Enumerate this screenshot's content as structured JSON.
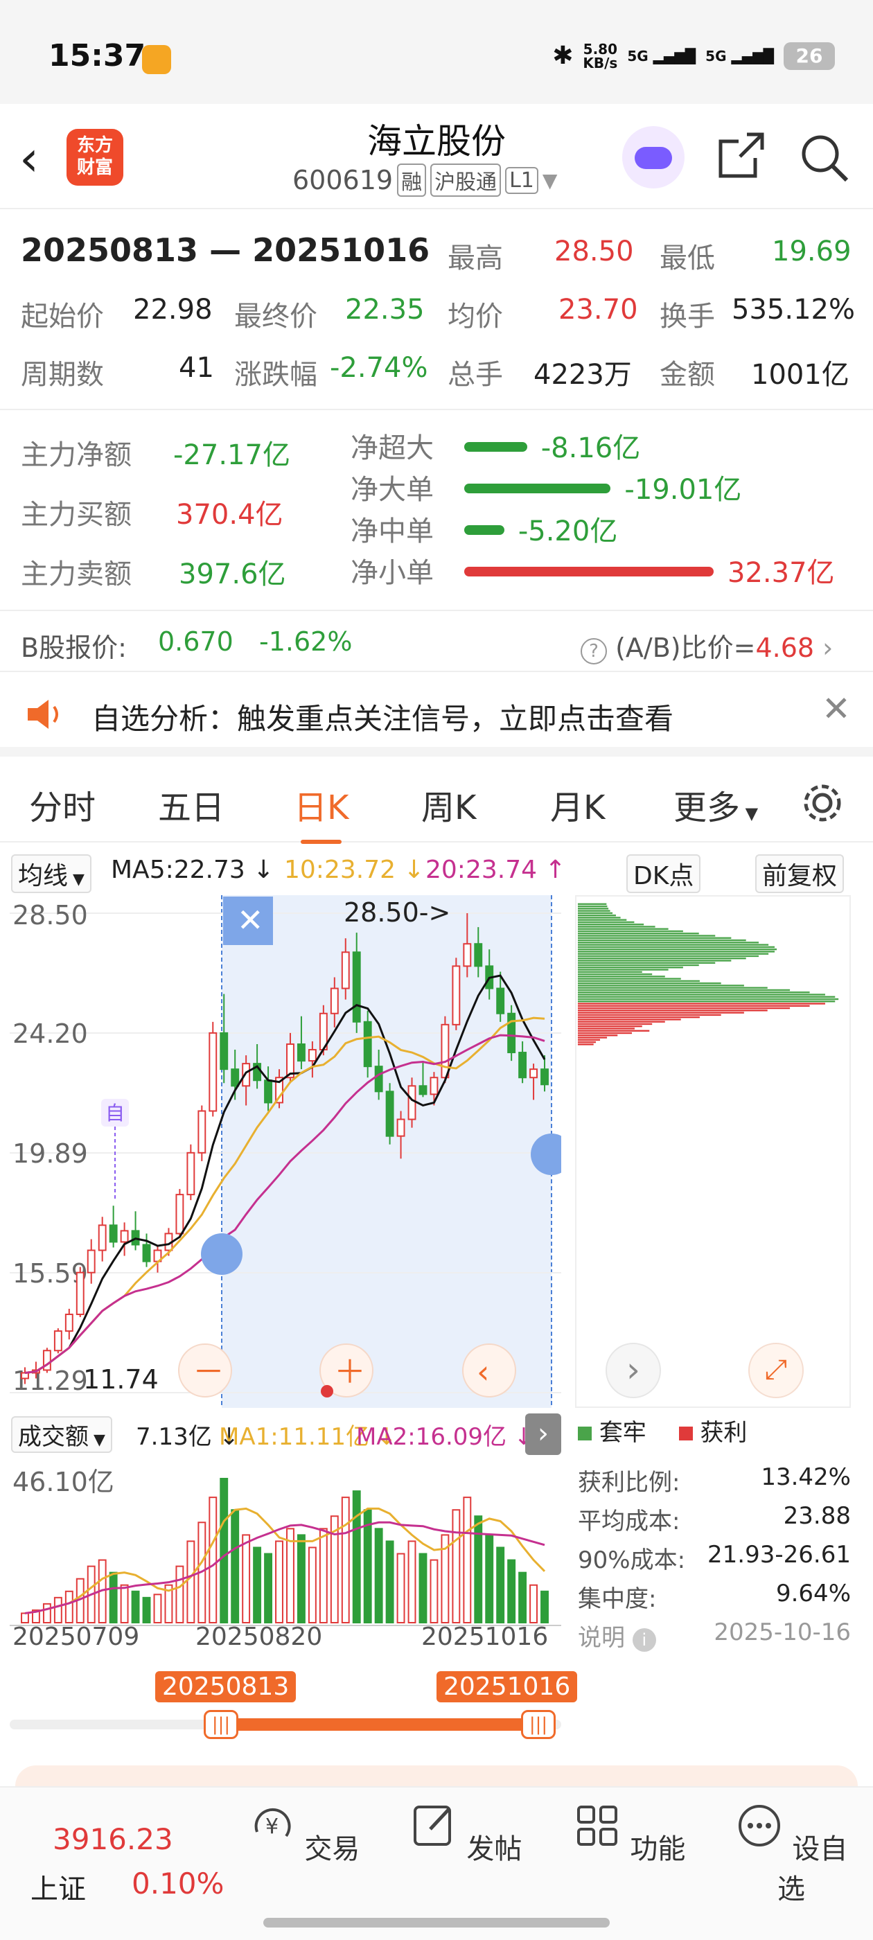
{
  "status": {
    "time": "15:37",
    "speed_value": "5.80",
    "speed_unit": "KB/s",
    "net1": "5G",
    "net2": "5G",
    "battery": "26"
  },
  "header": {
    "back_icon": "chevron-left-icon",
    "logo_line1": "东方",
    "logo_line2": "财富",
    "title": "海立股份",
    "code": "600619",
    "tags": [
      "融",
      "沪股通",
      "L1"
    ]
  },
  "range": {
    "label": "20250813 — 20251016"
  },
  "stats": {
    "high_label": "最高",
    "high": "28.50",
    "low_label": "最低",
    "low": "19.69",
    "start_label": "起始价",
    "start": "22.98",
    "end_label": "最终价",
    "end": "22.35",
    "avg_label": "均价",
    "avg": "23.70",
    "turnover_label": "换手",
    "turnover": "535.12%",
    "periods_label": "周期数",
    "periods": "41",
    "change_label": "涨跌幅",
    "change": "-2.74%",
    "hands_label": "总手",
    "hands": "4223万",
    "amount_label": "金额",
    "amount": "1001亿"
  },
  "fund": {
    "net_label": "主力净额",
    "net": "-27.17亿",
    "buy_label": "主力买额",
    "buy": "370.4亿",
    "sell_label": "主力卖额",
    "sell": "397.6亿",
    "flows": [
      {
        "label": "净超大",
        "value": "-8.16亿",
        "color": "#2e9e3a",
        "magnitude": 8.16
      },
      {
        "label": "净大单",
        "value": "-19.01亿",
        "color": "#2e9e3a",
        "magnitude": 19.01
      },
      {
        "label": "净中单",
        "value": "-5.20亿",
        "color": "#2e9e3a",
        "magnitude": 5.2
      },
      {
        "label": "净小单",
        "value": "32.37亿",
        "color": "#e03a3a",
        "magnitude": 32.37
      }
    ]
  },
  "bprice": {
    "label": "B股报价:",
    "price": "0.670",
    "change": "-1.62%",
    "ratio_label": "(A/B)比价=",
    "ratio": "4.68"
  },
  "alert": {
    "text": "自选分析：触发重点关注信号，立即点击查看"
  },
  "tabs": [
    "分时",
    "五日",
    "日K",
    "周K",
    "月K",
    "更多"
  ],
  "ma": {
    "selector": "均线",
    "ma5": "MA5:22.73 ↓",
    "ma10": "10:23.72 ↓",
    "ma20": "20:23.74 ↑",
    "dk": "DK点",
    "fq": "前复权"
  },
  "chart": {
    "y_labels": [
      "28.50",
      "24.20",
      "19.89",
      "15.59",
      "11.29"
    ],
    "peak_label": "28.50->",
    "low_label": "11.74",
    "marker": "自"
  },
  "volume": {
    "selector": "成交额",
    "val": "7.13亿 ↓",
    "ma1": "MA1:11.11亿 ↓",
    "ma2": "MA2:16.09亿 ↓",
    "max_label": "46.10亿",
    "date_start": "20250709",
    "date_mid": "20250820",
    "date_end": "20251016"
  },
  "range_flags": {
    "start": "20250813",
    "end": "20251016"
  },
  "chips": {
    "legend_hold": "套牢",
    "legend_profit": "获利",
    "rows": [
      {
        "label": "获利比例:",
        "value": "13.42%"
      },
      {
        "label": "平均成本:",
        "value": "23.88"
      },
      {
        "label": "90%成本:",
        "value": "21.93-26.61"
      },
      {
        "label": "集中度:",
        "value": "9.64%"
      }
    ],
    "note_label": "说明",
    "date": "2025-10-16"
  },
  "bottom": {
    "index_value": "3916.23",
    "index_name": "上证",
    "index_change": "0.10%",
    "items": [
      {
        "label": "交易",
        "icon": "yen-cycle-icon"
      },
      {
        "label": "发帖",
        "icon": "edit-icon"
      },
      {
        "label": "功能",
        "icon": "grid-icon"
      },
      {
        "label": "设自选",
        "icon": "more-icon"
      }
    ]
  },
  "chart_data": {
    "type": "candlestick",
    "x_start": "20250709",
    "x_end": "20251016",
    "ylim": [
      11.29,
      28.5
    ],
    "selection": [
      "20250813",
      "20251016"
    ],
    "ohlc": [
      [
        11.8,
        12.2,
        11.6,
        12.0
      ],
      [
        12.0,
        12.4,
        11.8,
        12.1
      ],
      [
        12.1,
        12.9,
        12.0,
        12.8
      ],
      [
        12.8,
        13.6,
        12.7,
        13.5
      ],
      [
        13.5,
        14.3,
        13.2,
        14.1
      ],
      [
        14.1,
        15.8,
        14.0,
        15.6
      ],
      [
        15.6,
        16.8,
        15.2,
        16.4
      ],
      [
        16.4,
        17.6,
        16.0,
        17.3
      ],
      [
        17.3,
        18.0,
        16.5,
        16.7
      ],
      [
        16.7,
        17.4,
        16.2,
        17.1
      ],
      [
        17.1,
        17.8,
        16.4,
        16.6
      ],
      [
        16.6,
        17.0,
        15.8,
        16.0
      ],
      [
        16.0,
        16.6,
        15.6,
        16.4
      ],
      [
        16.4,
        17.2,
        16.2,
        17.0
      ],
      [
        17.0,
        18.6,
        16.9,
        18.4
      ],
      [
        18.4,
        20.2,
        18.2,
        19.9
      ],
      [
        19.9,
        21.6,
        19.6,
        21.4
      ],
      [
        21.4,
        24.6,
        21.2,
        24.2
      ],
      [
        24.2,
        25.6,
        22.4,
        22.9
      ],
      [
        22.9,
        23.6,
        21.8,
        22.3
      ],
      [
        22.3,
        23.4,
        21.6,
        23.1
      ],
      [
        23.1,
        23.8,
        22.2,
        22.5
      ],
      [
        22.5,
        23.0,
        21.4,
        21.7
      ],
      [
        21.7,
        22.9,
        21.5,
        22.6
      ],
      [
        22.6,
        24.2,
        22.4,
        23.8
      ],
      [
        23.8,
        24.8,
        22.9,
        23.2
      ],
      [
        23.2,
        23.9,
        22.6,
        23.6
      ],
      [
        23.6,
        25.2,
        23.4,
        24.9
      ],
      [
        24.9,
        26.2,
        24.4,
        25.8
      ],
      [
        25.8,
        27.6,
        25.4,
        27.1
      ],
      [
        27.1,
        27.8,
        24.2,
        24.6
      ],
      [
        24.6,
        25.0,
        22.6,
        23.0
      ],
      [
        23.0,
        23.6,
        21.8,
        22.1
      ],
      [
        22.1,
        22.4,
        20.2,
        20.5
      ],
      [
        20.5,
        21.4,
        19.69,
        21.1
      ],
      [
        21.1,
        22.6,
        20.8,
        22.3
      ],
      [
        22.3,
        23.2,
        21.9,
        22.0
      ],
      [
        22.0,
        22.8,
        21.6,
        22.6
      ],
      [
        22.6,
        24.8,
        22.4,
        24.5
      ],
      [
        24.5,
        26.9,
        24.3,
        26.6
      ],
      [
        26.6,
        28.5,
        26.2,
        27.4
      ],
      [
        27.4,
        28.0,
        26.2,
        26.6
      ],
      [
        26.6,
        27.2,
        25.4,
        25.8
      ],
      [
        25.8,
        26.4,
        24.6,
        24.9
      ],
      [
        24.9,
        25.2,
        23.2,
        23.5
      ],
      [
        23.5,
        23.9,
        22.4,
        22.6
      ],
      [
        22.6,
        23.1,
        21.8,
        22.9
      ],
      [
        22.9,
        23.4,
        22.1,
        22.35
      ]
    ],
    "volume": [
      3,
      4,
      6,
      8,
      10,
      14,
      18,
      20,
      16,
      12,
      10,
      8,
      9,
      12,
      18,
      26,
      32,
      40,
      46,
      36,
      28,
      24,
      22,
      26,
      30,
      28,
      24,
      30,
      34,
      40,
      42,
      36,
      30,
      26,
      22,
      26,
      22,
      20,
      28,
      36,
      40,
      34,
      28,
      24,
      20,
      16,
      12,
      10
    ]
  }
}
